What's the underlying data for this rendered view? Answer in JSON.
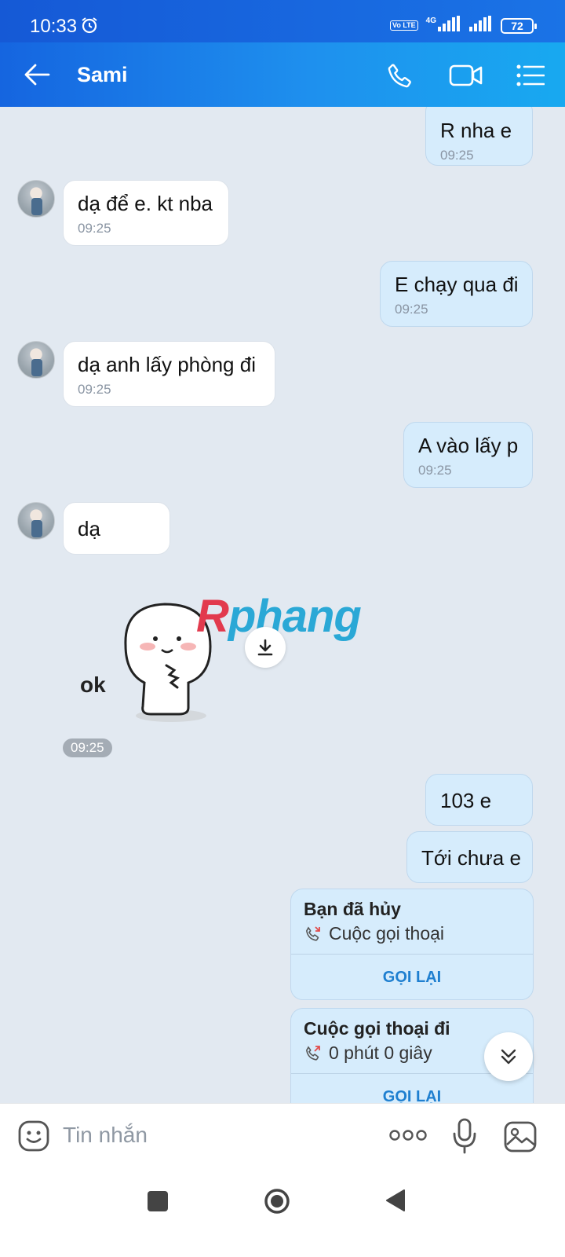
{
  "status_bar": {
    "time": "10:33",
    "network": "4G",
    "volte": "Vo LTE",
    "battery": "72"
  },
  "header": {
    "title": "Sami"
  },
  "messages": [
    {
      "side": "out",
      "text": "R nha e",
      "time": "09:25"
    },
    {
      "side": "in",
      "text": "dạ để e. kt nba",
      "time": "09:25"
    },
    {
      "side": "out",
      "text": "E chạy qua đi",
      "time": "09:25"
    },
    {
      "side": "in",
      "text": "dạ anh lấy phòng đi",
      "time": "09:25"
    },
    {
      "side": "out",
      "text": "A vào lấy p",
      "time": "09:25"
    },
    {
      "side": "in",
      "text": "dạ",
      "time": ""
    },
    {
      "side": "in",
      "type": "sticker",
      "caption": "ok",
      "time": "09:25"
    },
    {
      "side": "out",
      "text": "103 e",
      "time": ""
    },
    {
      "side": "out",
      "text": "Tới chưa e",
      "time": ""
    }
  ],
  "sticker": {
    "caption": "ok",
    "time": "09:25"
  },
  "watermark": {
    "part1": "R",
    "part2": "phang"
  },
  "call_cards": [
    {
      "title": "Bạn đã hủy",
      "subtitle": "Cuộc gọi thoại",
      "button": "GỌI LẠI"
    },
    {
      "title": "Cuộc gọi thoại đi",
      "subtitle": "0 phút 0 giây",
      "button": "GỌI LẠI"
    }
  ],
  "input": {
    "placeholder": "Tin nhắn"
  },
  "colors": {
    "header_start": "#1565e0",
    "header_end": "#18a9f0",
    "outgoing_bubble": "#d6ecfc",
    "incoming_bubble": "#ffffff",
    "accent": "#1e7fd0"
  }
}
